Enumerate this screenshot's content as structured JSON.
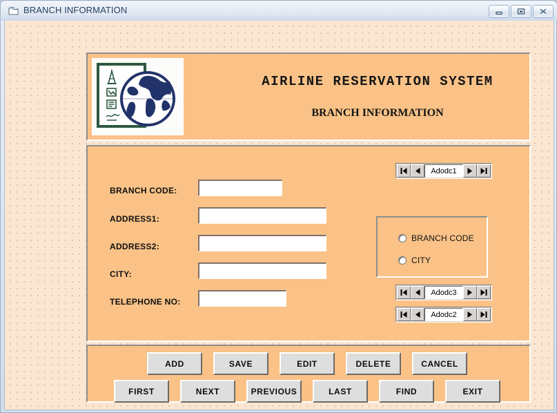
{
  "window": {
    "title": "BRANCH INFORMATION",
    "title_icon": "form-window-icon",
    "controls": [
      {
        "name": "minimize-button",
        "icon": "minimize-icon"
      },
      {
        "name": "maximize-button",
        "icon": "maximize-icon"
      },
      {
        "name": "close-button",
        "icon": "close-icon"
      }
    ]
  },
  "header": {
    "logo_icon": "globe-travel-logo",
    "app_title": "AIRLINE  RESERVATION  SYSTEM",
    "app_subtitle": "BRANCH INFORMATION"
  },
  "form": {
    "fields": [
      {
        "name": "branch-code",
        "label": "BRANCH CODE:",
        "value": "",
        "placeholder": ""
      },
      {
        "name": "address1",
        "label": "ADDRESS1:",
        "value": "",
        "placeholder": ""
      },
      {
        "name": "address2",
        "label": "ADDRESS2:",
        "value": "",
        "placeholder": ""
      },
      {
        "name": "city",
        "label": "CITY:",
        "value": "",
        "placeholder": ""
      },
      {
        "name": "telephone-no",
        "label": "TELEPHONE NO:",
        "value": "",
        "placeholder": ""
      }
    ]
  },
  "search_group": {
    "options": [
      {
        "name": "branch-code",
        "label": "BRANCH CODE",
        "selected": false
      },
      {
        "name": "city",
        "label": "CITY",
        "selected": false
      }
    ]
  },
  "data_controls": [
    {
      "name": "adodc1",
      "caption": "Adodc1"
    },
    {
      "name": "adodc3",
      "caption": "Adodc3"
    },
    {
      "name": "adodc2",
      "caption": "Adodc2"
    }
  ],
  "buttons": {
    "row1": [
      {
        "name": "add-button",
        "label": "ADD"
      },
      {
        "name": "save-button",
        "label": "SAVE"
      },
      {
        "name": "edit-button",
        "label": "EDIT"
      },
      {
        "name": "delete-button",
        "label": "DELETE"
      },
      {
        "name": "cancel-button",
        "label": "CANCEL"
      }
    ],
    "row2": [
      {
        "name": "first-button",
        "label": "FIRST"
      },
      {
        "name": "next-button",
        "label": "NEXT"
      },
      {
        "name": "previous-button",
        "label": "PREVIOUS"
      },
      {
        "name": "last-button",
        "label": "LAST"
      },
      {
        "name": "find-button",
        "label": "FIND"
      },
      {
        "name": "exit-button",
        "label": "EXIT"
      }
    ]
  },
  "colors": {
    "panel": "#fac287",
    "form_background": "#fbe6d1",
    "button_face": "#dedede",
    "titlebar_text": "#27405e",
    "logo_navy": "#22336b",
    "logo_green": "#2d5840"
  }
}
